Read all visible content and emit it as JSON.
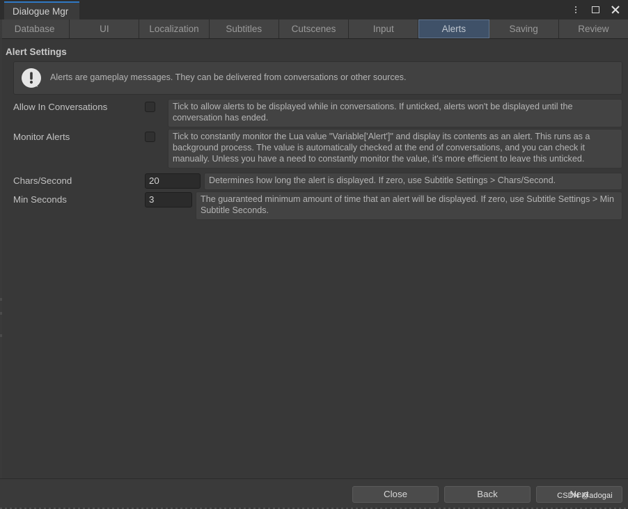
{
  "window": {
    "tab_title": "Dialogue Mgr",
    "controls": {
      "menu": "kebab-menu-icon",
      "maximize": "maximize-icon",
      "close": "close-icon"
    }
  },
  "tabstrip": {
    "tabs": [
      {
        "label": "Database",
        "selected": false
      },
      {
        "label": "UI",
        "selected": false
      },
      {
        "label": "Localization",
        "selected": false
      },
      {
        "label": "Subtitles",
        "selected": false
      },
      {
        "label": "Cutscenes",
        "selected": false
      },
      {
        "label": "Input",
        "selected": false
      },
      {
        "label": "Alerts",
        "selected": true
      },
      {
        "label": "Saving",
        "selected": false
      },
      {
        "label": "Review",
        "selected": false
      }
    ]
  },
  "main": {
    "section_title": "Alert Settings",
    "helpbox": {
      "icon": "info-speech-bubble-icon",
      "text": "Alerts are gameplay messages. They can be delivered from conversations or other sources."
    },
    "fields": [
      {
        "label": "Allow In Conversations",
        "type": "checkbox",
        "checked": false,
        "tip": "Tick to allow alerts to be displayed while in conversations. If unticked, alerts won't be displayed until the conversation has ended."
      },
      {
        "label": "Monitor Alerts",
        "type": "checkbox",
        "checked": false,
        "tip": "Tick to constantly monitor the Lua value \"Variable['Alert']\" and display its contents as an alert. This runs as a background process. The value is automatically checked at the end of conversations, and you can check it manually. Unless you have a need to constantly monitor the value, it's more efficient to leave this unticked."
      },
      {
        "label": "Chars/Second",
        "type": "number",
        "value": "20",
        "tip": "Determines how long the alert is displayed. If zero, use Subtitle Settings > Chars/Second."
      },
      {
        "label": "Min Seconds",
        "type": "number",
        "value": "3",
        "tip": "The guaranteed minimum amount of time that an alert will be displayed. If zero, use Subtitle Settings > Min Subtitle Seconds."
      }
    ]
  },
  "footer": {
    "buttons": [
      {
        "label": "Close"
      },
      {
        "label": "Back"
      },
      {
        "label": "Next"
      }
    ],
    "watermark": "CSDN @adogai"
  },
  "colors": {
    "window_bg": "#383838",
    "titlebar_bg": "#2d2d2d",
    "tab_accent": "#2f79c5",
    "tab_selected_bg": "#3f5168",
    "tab_unselected_bg": "#434343",
    "field_bg": "#434343",
    "input_bg": "#2b2b2b",
    "text": "#b8b8b8"
  }
}
